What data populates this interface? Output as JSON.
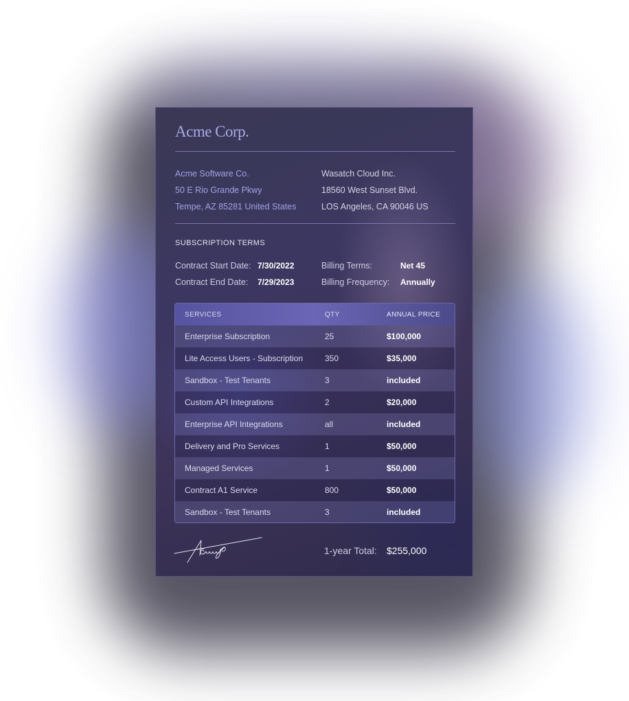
{
  "logo": "Acme Corp.",
  "seller": {
    "name": "Acme Software Co.",
    "street": "50 E Rio Grande Pkwy",
    "city": "Tempe, AZ 85281 United States"
  },
  "buyer": {
    "name": "Wasatch Cloud Inc.",
    "street": "18560 West Sunset Blvd.",
    "city": "LOS Angeles, CA 90046 US"
  },
  "terms": {
    "heading": "SUBSCRIPTION TERMS",
    "start_label": "Contract Start Date:",
    "start_value": "7/30/2022",
    "end_label": "Contract End Date:",
    "end_value": "7/29/2023",
    "billing_terms_label": "Billing Terms:",
    "billing_terms_value": "Net 45",
    "billing_freq_label": "Billing Frequency:",
    "billing_freq_value": "Annually"
  },
  "table": {
    "headers": [
      "SERVICES",
      "QTY",
      "ANNUAL PRICE"
    ],
    "rows": [
      [
        "Enterprise Subscription",
        "25",
        "$100,000"
      ],
      [
        "Lite Access Users - Subscription",
        "350",
        "$35,000"
      ],
      [
        "Sandbox - Test Tenants",
        "3",
        "included"
      ],
      [
        "Custom API Integrations",
        "2",
        "$20,000"
      ],
      [
        "Enterprise API Integrations",
        "all",
        "included"
      ],
      [
        "Delivery and Pro Services",
        "1",
        "$50,000"
      ],
      [
        "Managed Services",
        "1",
        "$50,000"
      ],
      [
        "Contract A1 Service",
        "800",
        "$50,000"
      ],
      [
        "Sandbox - Test Tenants",
        "3",
        "included"
      ]
    ]
  },
  "footer": {
    "total_label": "1-year Total:",
    "total_value": "$255,000",
    "signature": "Acmego"
  }
}
